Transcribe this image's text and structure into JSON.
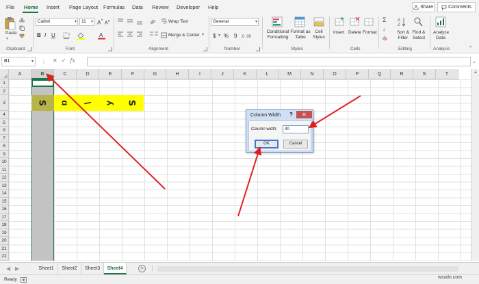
{
  "ribbon_tabs": [
    "File",
    "Home",
    "Insert",
    "Page Layout",
    "Formulas",
    "Data",
    "Review",
    "Developer",
    "Help"
  ],
  "active_tab": "Home",
  "share_label": "Share",
  "comments_label": "Comments",
  "clipboard": {
    "paste_label": "Paste",
    "group_label": "Clipboard"
  },
  "font": {
    "name": "Calibri",
    "size": "11",
    "group_label": "Font"
  },
  "alignment": {
    "wrap_text": "Wrap Text",
    "merge_center": "Merge & Center",
    "group_label": "Alignment"
  },
  "number": {
    "format": "General",
    "currency": "$",
    "percent": "%",
    "comma": "9",
    "group_label": "Number"
  },
  "styles": {
    "conditional_formatting": "Conditional Formatting",
    "format_as_table": "Format as Table",
    "cell_styles": "Cell Styles",
    "group_label": "Styles"
  },
  "cells": {
    "insert": "Insert",
    "delete": "Delete",
    "format": "Format",
    "group_label": "Cells"
  },
  "editing": {
    "sort_filter": "Sort & Filter",
    "find_select": "Find & Select",
    "group_label": "Editing"
  },
  "analysis": {
    "analyze_data": "Analyze Data",
    "group_label": "Analysis"
  },
  "formula_bar": {
    "name_box": "B1",
    "fx": "fx",
    "value": ""
  },
  "columns": [
    "A",
    "B",
    "C",
    "D",
    "E",
    "F",
    "G",
    "H",
    "I",
    "J",
    "K",
    "L",
    "M",
    "N",
    "O",
    "P",
    "Q",
    "R",
    "S",
    "T"
  ],
  "selected_column": "B",
  "rows": [
    "1",
    "2",
    "3",
    "4",
    "5",
    "6",
    "7",
    "8",
    "9",
    "10",
    "11",
    "12",
    "13",
    "14",
    "15",
    "16",
    "17",
    "18",
    "19",
    "20",
    "21",
    "22"
  ],
  "row3_glyphs": [
    "ꓢ",
    "ɑ",
    "\\",
    "ʎ",
    "ꓢ"
  ],
  "dialog": {
    "title": "Column Width",
    "help": "?",
    "close": "✕",
    "label": "Column width:",
    "value": "40",
    "ok": "OK",
    "cancel": "Cancel"
  },
  "sheets": [
    "Sheet1",
    "Sheet2",
    "Sheet3",
    "Sheet4"
  ],
  "active_sheet": "Sheet4",
  "status": "Ready",
  "watermark": "wsxdn.com",
  "colors": {
    "accent": "#217346",
    "highlight": "#ffff00",
    "arrow": "#e21f1f",
    "selection": "#c3c3c3"
  }
}
